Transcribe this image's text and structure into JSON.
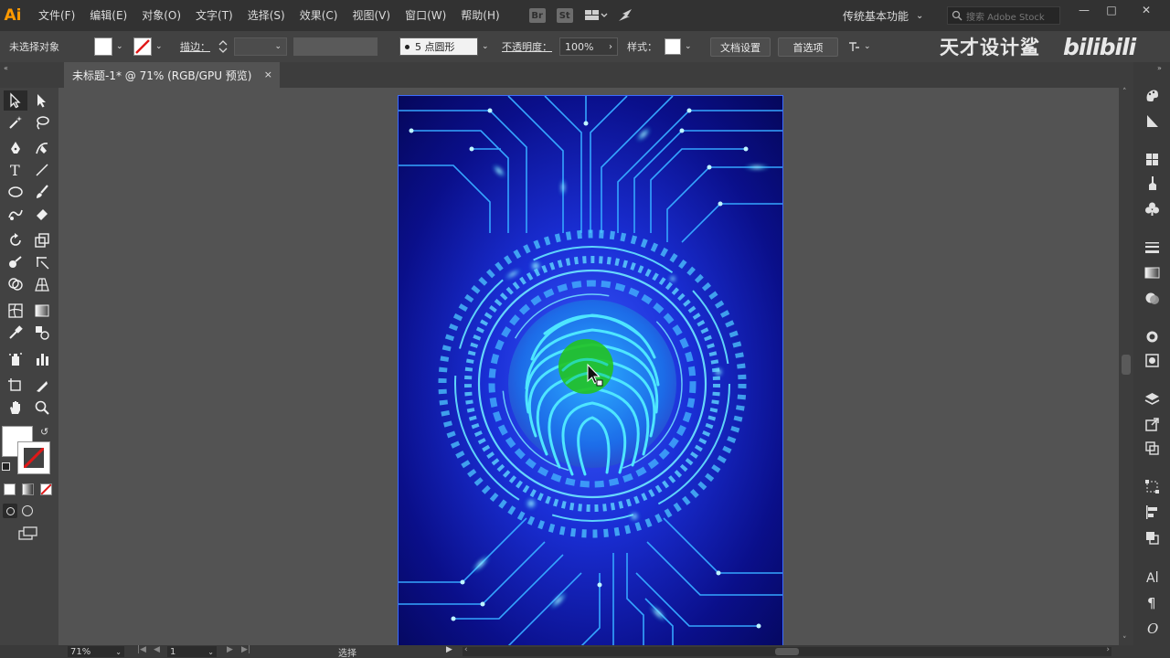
{
  "app": {
    "logo": "Ai",
    "accent": "#ff9a00"
  },
  "menu": {
    "items": [
      "文件(F)",
      "编辑(E)",
      "对象(O)",
      "文字(T)",
      "选择(S)",
      "效果(C)",
      "视图(V)",
      "窗口(W)",
      "帮助(H)"
    ],
    "icon_st": "St",
    "workspace": "传统基本功能",
    "search_placeholder": "搜索 Adobe Stock"
  },
  "control_bar": {
    "selection_status": "未选择对象",
    "stroke_label": "描边：",
    "brush_label": "5 点圆形",
    "opacity_label": "不透明度：",
    "opacity_value": "100%",
    "style_label": "样式：",
    "doc_setup_button": "文档设置",
    "preferences_button": "首选项"
  },
  "watermark": {
    "brand_text": "天才设计鲨",
    "platform": "bilibili"
  },
  "document_tab": {
    "title": "未标题-1* @ 71% (RGB/GPU 预览)",
    "close": "×"
  },
  "status_bar": {
    "zoom": "71%",
    "artboard_number": "1",
    "tool_status": "选择"
  },
  "colors": {
    "menubar_bg": "#323232",
    "controlbar_bg": "#424242",
    "canvas_bg": "#535353",
    "artboard_border": "#3b6cff",
    "artwork_glow": "#22d4ff",
    "artwork_deep": "#070a6b",
    "highlight": "#22c322"
  },
  "icons": {
    "left_toolbar": [
      "selection-tool-icon",
      "direct-selection-tool-icon",
      "magic-wand-icon",
      "lasso-icon",
      "pen-tool-icon",
      "curvature-tool-icon",
      "type-tool-icon",
      "line-tool-icon",
      "ellipse-tool-icon",
      "paintbrush-icon",
      "shaper-tool-icon",
      "eraser-icon",
      "rotate-tool-icon",
      "scale-tool-icon",
      "warp-tool-icon",
      "free-transform-icon",
      "shape-builder-icon",
      "perspective-grid-icon",
      "mesh-tool-icon",
      "gradient-tool-icon",
      "eyedropper-icon",
      "blend-tool-icon",
      "symbol-sprayer-icon",
      "column-graph-icon",
      "artboard-tool-icon",
      "slice-tool-icon",
      "hand-tool-icon",
      "zoom-tool-icon"
    ],
    "right_dock": [
      "color-panel-icon",
      "color-guide-icon",
      "swatches-icon",
      "brushes-icon",
      "symbols-icon",
      "stroke-panel-icon",
      "gradient-panel-icon",
      "transparency-icon",
      "appearance-icon",
      "graphic-styles-icon",
      "layers-icon",
      "export-icon",
      "artboards-icon",
      "transform-icon",
      "align-icon",
      "pathfinder-icon",
      "character-icon",
      "paragraph-icon",
      "opentype-icon"
    ]
  }
}
